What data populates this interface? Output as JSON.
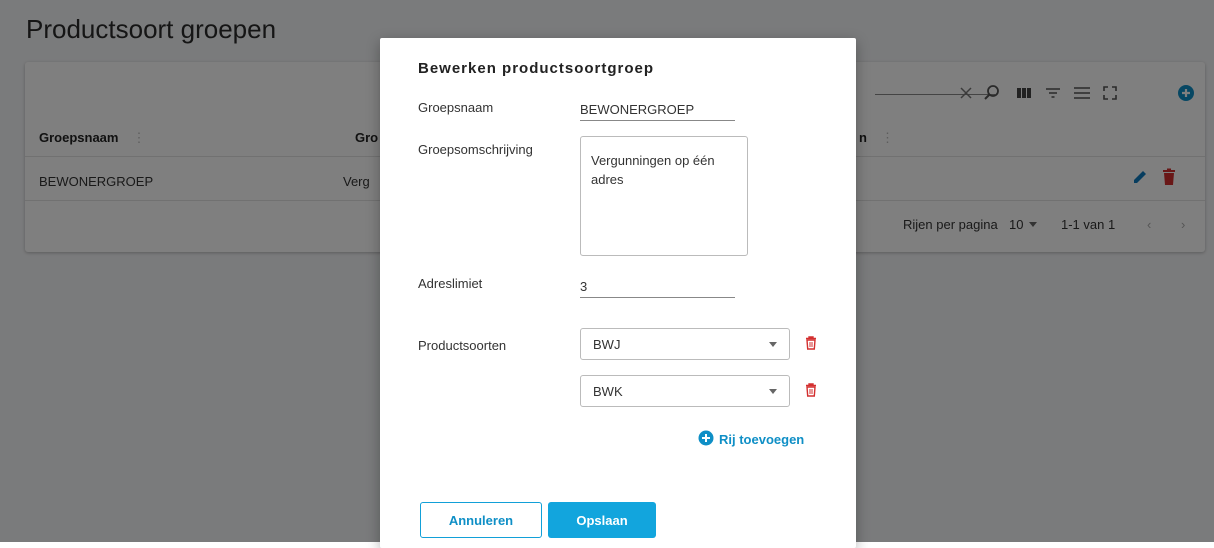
{
  "page": {
    "title": "Productsoort groepen"
  },
  "table": {
    "columns": [
      "Groepsnaam",
      "Gro",
      "n"
    ],
    "rows": [
      {
        "groepsnaam": "BEWONERGROEP",
        "omschrijving": "Verg"
      }
    ],
    "pagination": {
      "rows_per_page_label": "Rijen per pagina",
      "rows_per_page": "10",
      "range": "1-1 van 1"
    }
  },
  "toolbar": {
    "icons": [
      "close-icon",
      "search-icon",
      "columns-icon",
      "filter-icon",
      "density-icon",
      "fullscreen-icon",
      "add-icon"
    ],
    "accent": "#0f8fc6"
  },
  "dialog": {
    "title": "Bewerken productsoortgroep",
    "groepsnaam_label": "Groepsnaam",
    "groepsnaam_value": "BEWONERGROEP",
    "omschrijving_label": "Groepsomschrijving",
    "omschrijving_value": "Vergunningen op één adres",
    "adreslimiet_label": "Adreslimiet",
    "adreslimiet_value": "3",
    "productsoorten_label": "Productsoorten",
    "productsoorten": [
      "BWJ",
      "BWK"
    ],
    "add_row_label": "Rij toevoegen",
    "cancel_label": "Annuleren",
    "save_label": "Opslaan"
  },
  "colors": {
    "primary": "#12a5dd",
    "delete": "#d32f2f",
    "edit": "#0f7bbf"
  }
}
